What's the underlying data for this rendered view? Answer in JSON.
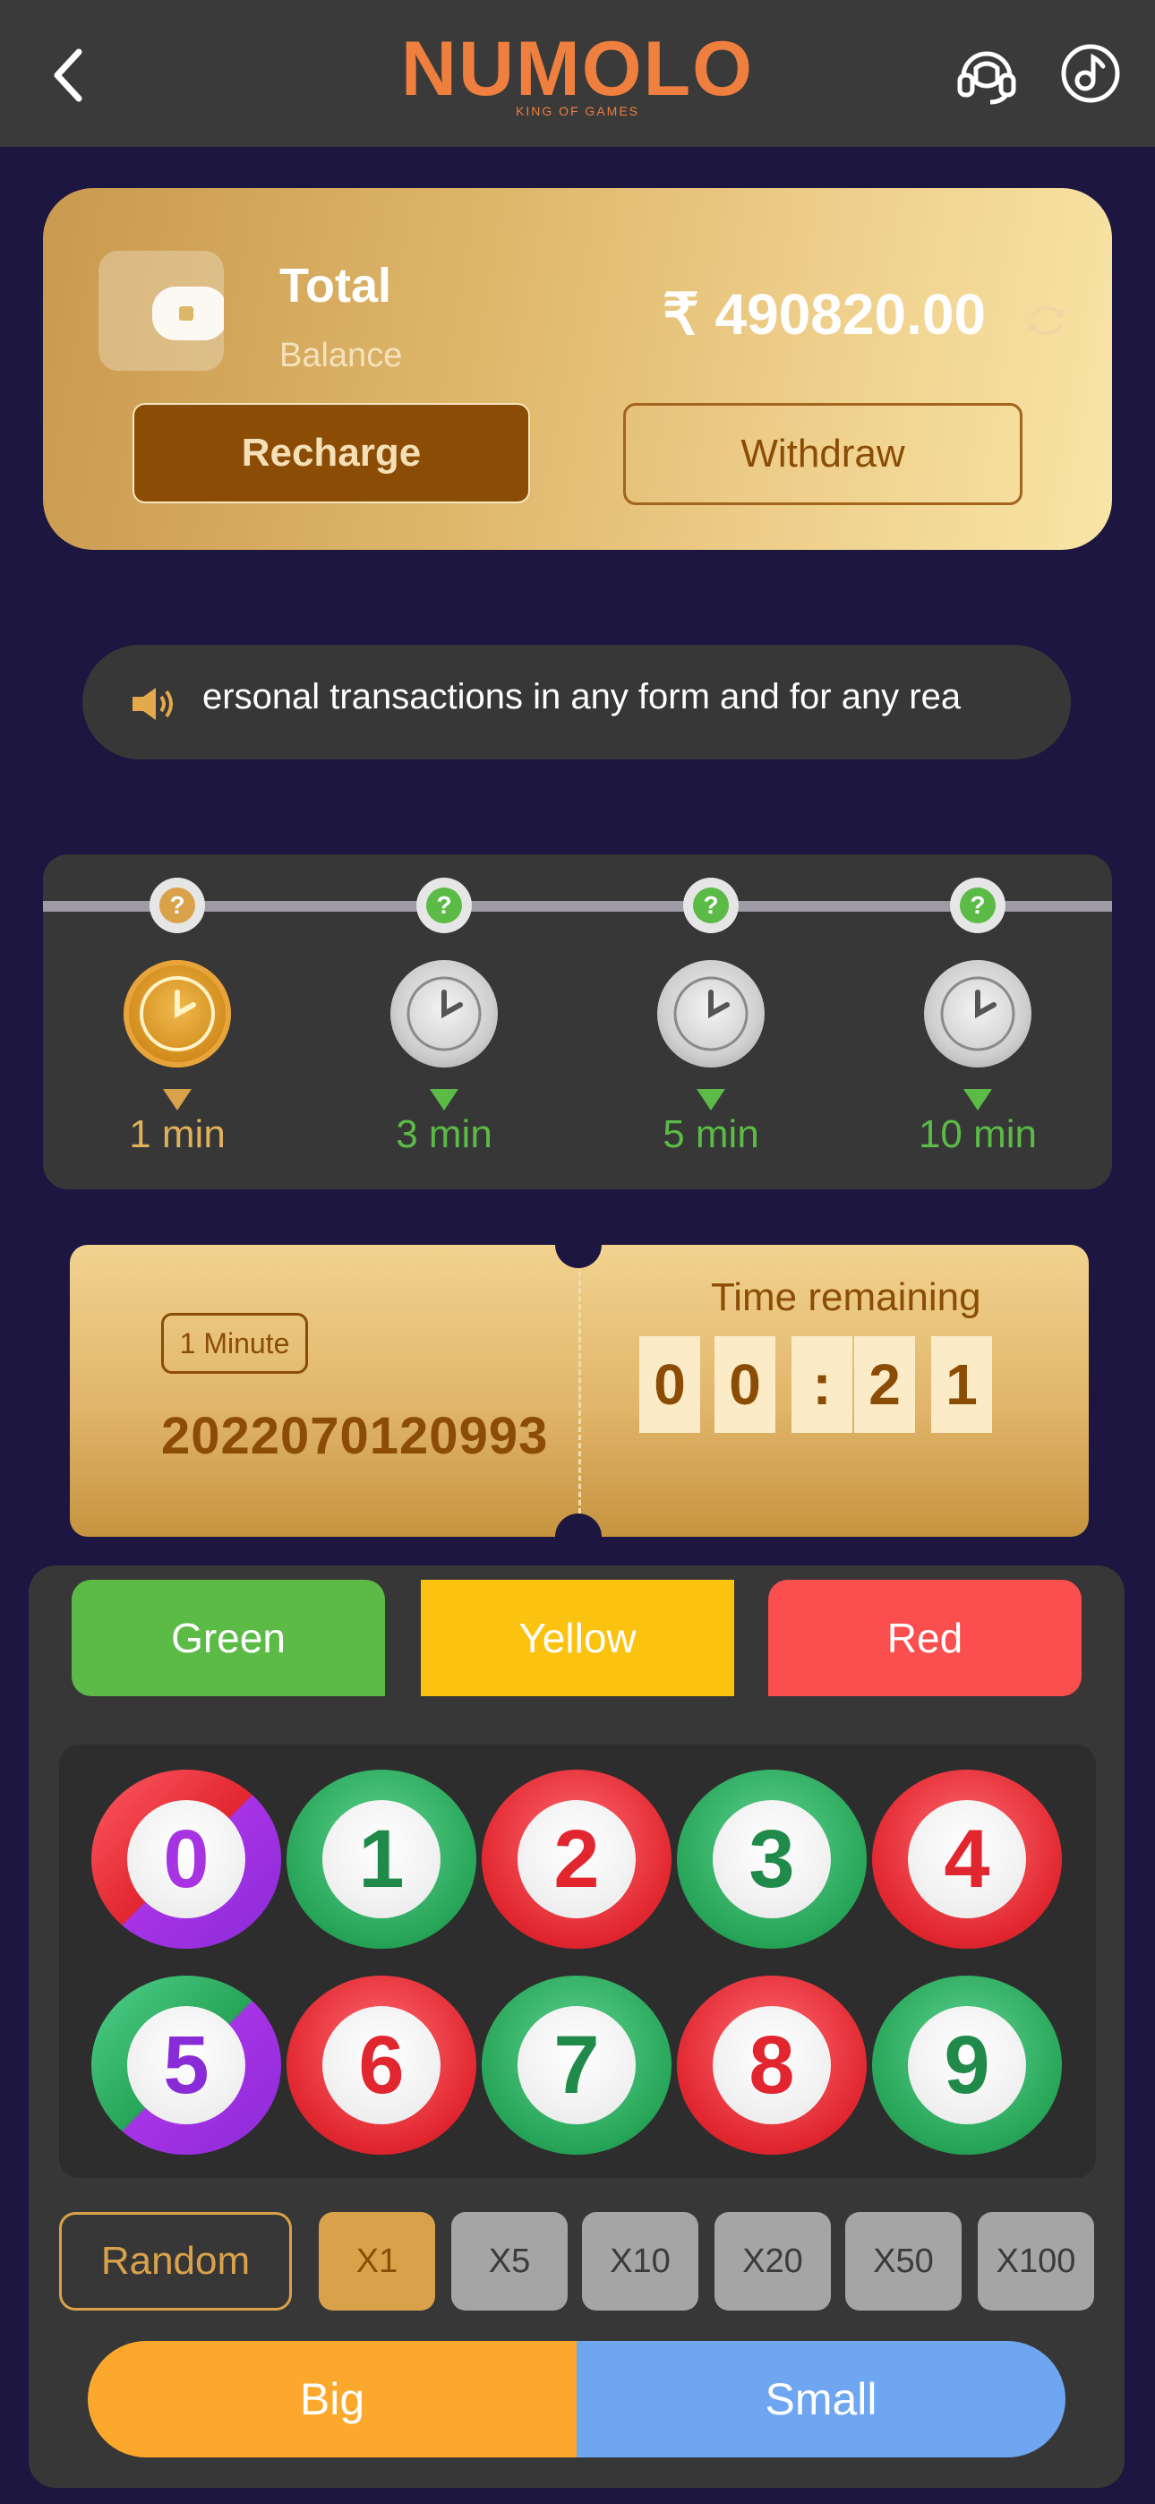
{
  "header": {
    "logo_text": "NUMOLO",
    "logo_tagline": "KING OF GAMES",
    "icons": [
      "back-arrow-icon",
      "headset-icon",
      "music-note-icon"
    ]
  },
  "balance": {
    "title": "Total",
    "subtitle": "Balance",
    "amount": "₹ 490820.00",
    "recharge_label": "Recharge",
    "withdraw_label": "Withdraw"
  },
  "notice": {
    "text": "ersonal transactions in any form and for any rea"
  },
  "timers": [
    {
      "label": "1 min",
      "active": true
    },
    {
      "label": "3 min",
      "active": false
    },
    {
      "label": "5 min",
      "active": false
    },
    {
      "label": "10 min",
      "active": false
    }
  ],
  "round": {
    "badge": "1 Minute",
    "period": "2022070120993",
    "time_label": "Time remaining",
    "digits": [
      "0",
      "0",
      ":",
      "2",
      "1"
    ]
  },
  "colors": {
    "green_label": "Green",
    "yellow_label": "Yellow",
    "red_label": "Red",
    "green_hex": "#5cba47",
    "yellow_hex": "#fbc20f",
    "red_hex": "#fb4e4e"
  },
  "numbers": [
    "0",
    "1",
    "2",
    "3",
    "4",
    "5",
    "6",
    "7",
    "8",
    "9"
  ],
  "controls": {
    "random_label": "Random",
    "multipliers": [
      "X1",
      "X5",
      "X10",
      "X20",
      "X50",
      "X100"
    ],
    "selected_multiplier": "X1",
    "big_label": "Big",
    "small_label": "Small"
  }
}
